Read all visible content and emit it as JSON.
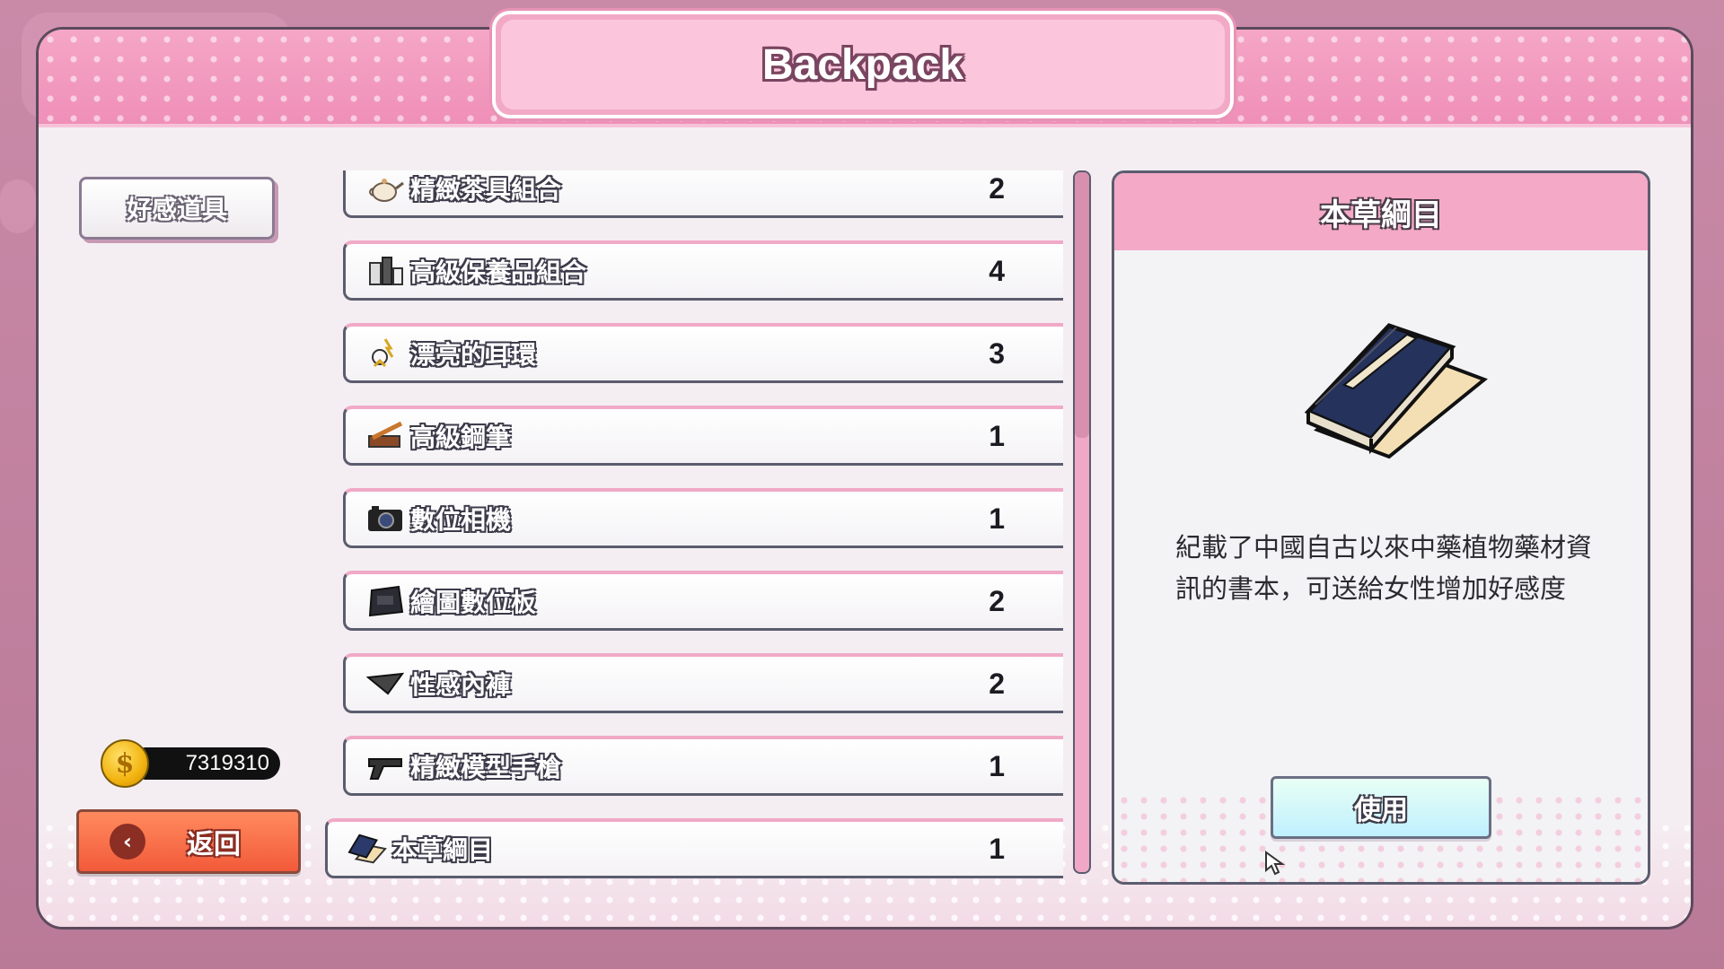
{
  "window": {
    "title": "Backpack"
  },
  "sidebar": {
    "category": "好感道具"
  },
  "currency": {
    "icon": "gold-coin-icon",
    "amount": "7319310"
  },
  "back_button": {
    "label": "返回",
    "icon": "arrow-left-icon"
  },
  "items": [
    {
      "name": "精緻茶具組合",
      "qty": "2",
      "icon": "teapot-icon"
    },
    {
      "name": "高級保養品組合",
      "qty": "4",
      "icon": "cosmetics-icon"
    },
    {
      "name": "漂亮的耳環",
      "qty": "3",
      "icon": "earrings-icon"
    },
    {
      "name": "高級鋼筆",
      "qty": "1",
      "icon": "pen-icon"
    },
    {
      "name": "數位相機",
      "qty": "1",
      "icon": "camera-icon"
    },
    {
      "name": "繪圖數位板",
      "qty": "2",
      "icon": "drawing-tablet-icon"
    },
    {
      "name": "性感內褲",
      "qty": "2",
      "icon": "underwear-icon"
    },
    {
      "name": "精緻模型手槍",
      "qty": "1",
      "icon": "pistol-icon"
    },
    {
      "name": "本草綱目",
      "qty": "1",
      "icon": "book-icon",
      "selected": true
    }
  ],
  "detail": {
    "title": "本草綱目",
    "description": "紀載了中國自古以來中藥植物藥材資訊的書本，可送給女性增加好感度",
    "use_label": "使用",
    "image_icon": "book-icon"
  },
  "colors": {
    "accent_pink": "#f4a9c7",
    "back_red": "#f25a3a",
    "use_cyan": "#bff0ff"
  }
}
